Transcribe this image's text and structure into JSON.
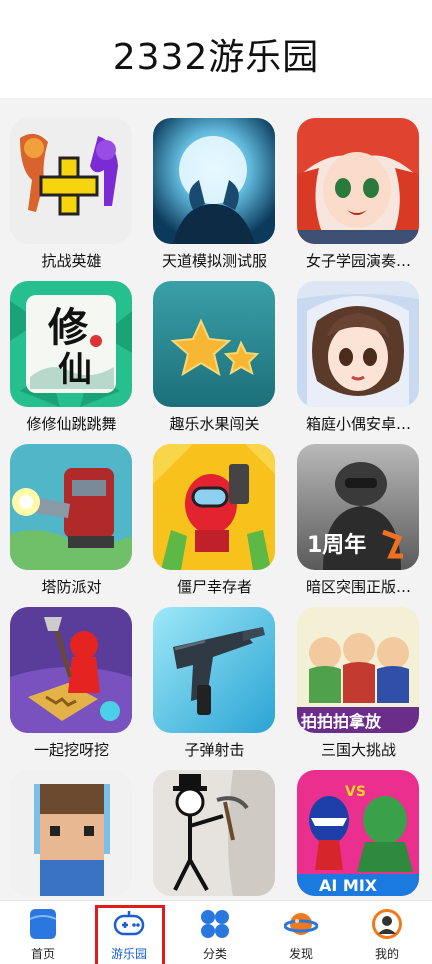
{
  "header": {
    "title": "2332游乐园"
  },
  "games": [
    {
      "name": "抗战英雄"
    },
    {
      "name": "天道模拟测试服"
    },
    {
      "name": "女子学园演奏…"
    },
    {
      "name": "修修仙跳跳舞"
    },
    {
      "name": "趣乐水果闯关"
    },
    {
      "name": "箱庭小偶安卓…"
    },
    {
      "name": "塔防派对"
    },
    {
      "name": "僵尸幸存者"
    },
    {
      "name": "暗区突围正版…"
    },
    {
      "name": "一起挖呀挖"
    },
    {
      "name": "子弹射击"
    },
    {
      "name": "三国大挑战"
    }
  ],
  "icon_texts": {
    "xiuxian_1": "修",
    "xiuxian_2": "仙",
    "anniversary": "1周年",
    "sanguo_banner": "拍拍拍拿放",
    "aimix": "AI MIX",
    "vs": "VS"
  },
  "tabbar": {
    "items": [
      {
        "label": "首页",
        "icon": "home-icon"
      },
      {
        "label": "游乐园",
        "icon": "gamepad-icon",
        "active": true
      },
      {
        "label": "分类",
        "icon": "category-icon"
      },
      {
        "label": "发现",
        "icon": "planet-icon"
      },
      {
        "label": "我的",
        "icon": "profile-icon"
      }
    ]
  },
  "colors": {
    "active_tab": "#1a5fd0",
    "highlight_frame": "#e11c1c"
  }
}
